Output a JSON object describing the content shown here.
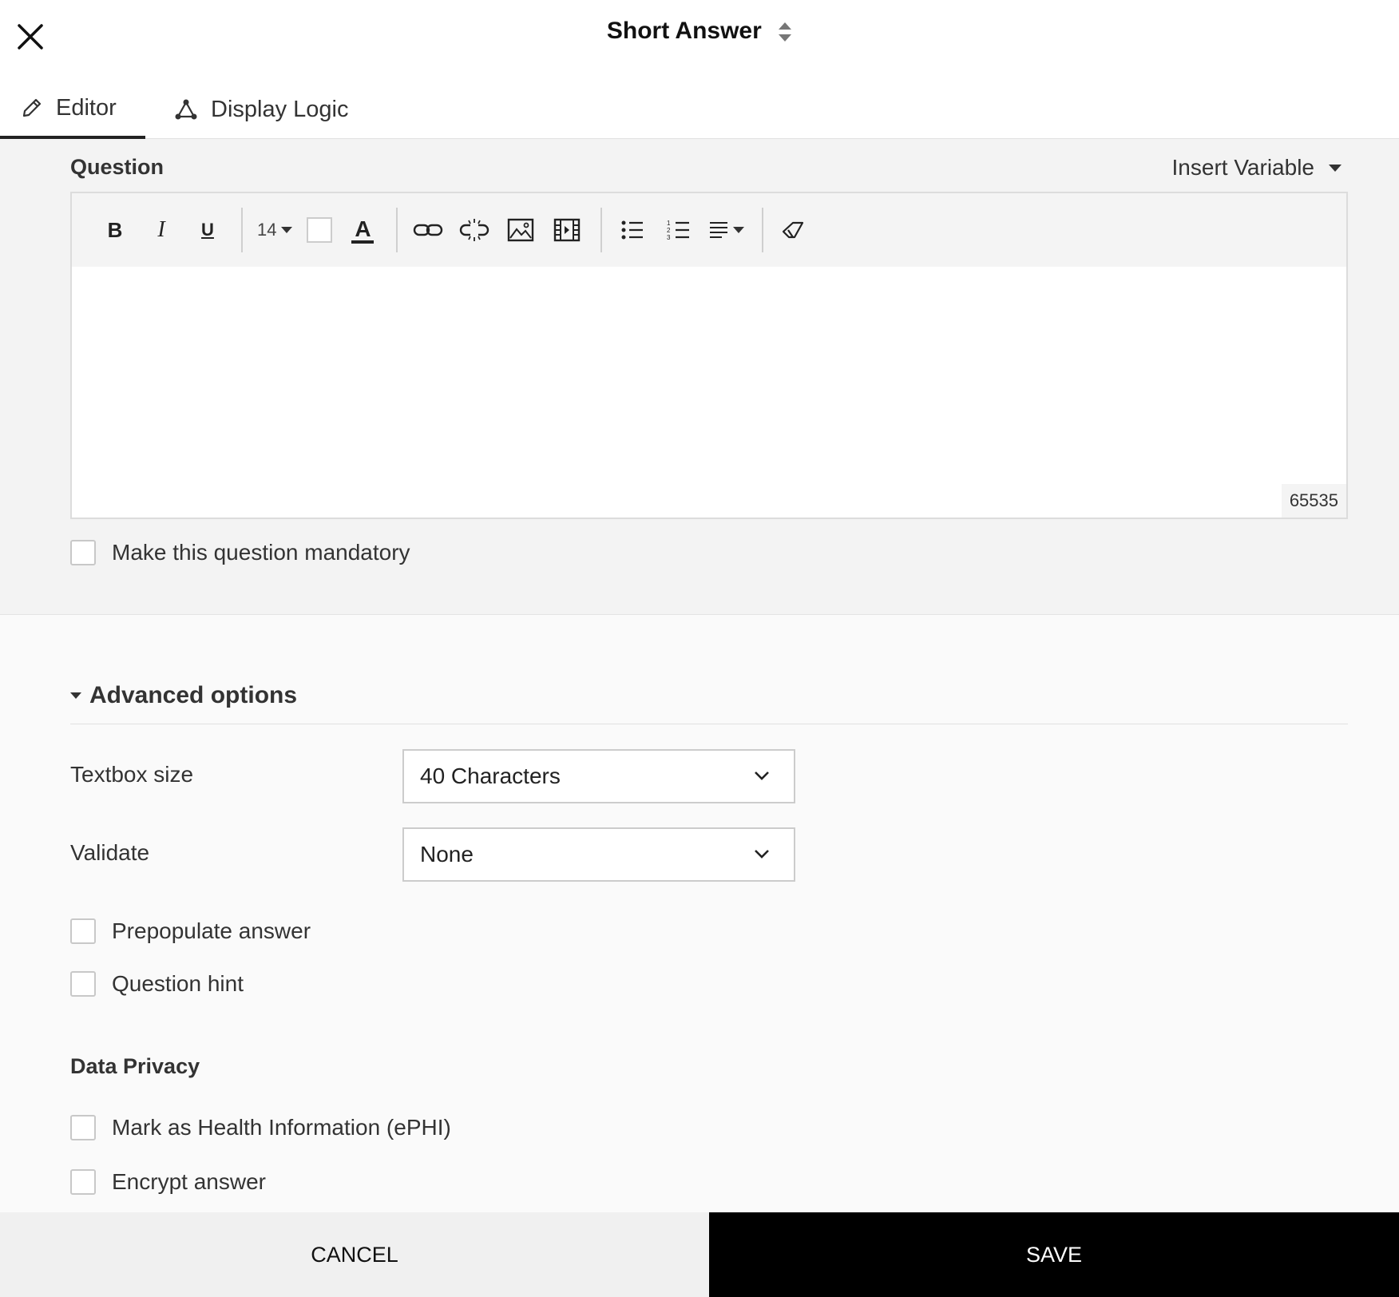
{
  "header": {
    "title": "Short Answer",
    "tabs": [
      {
        "label": "Editor",
        "active": true,
        "icon": "pencil-icon"
      },
      {
        "label": "Display Logic",
        "active": false,
        "icon": "logic-nodes-icon"
      }
    ]
  },
  "question": {
    "label": "Question",
    "insert_variable": "Insert Variable",
    "font_size": "14",
    "char_count": "65535",
    "mandatory_label": "Make this question mandatory"
  },
  "advanced": {
    "title": "Advanced options",
    "textbox_size_label": "Textbox size",
    "textbox_size_value": "40 Characters",
    "validate_label": "Validate",
    "validate_value": "None",
    "prepopulate_label": "Prepopulate answer",
    "hint_label": "Question hint"
  },
  "privacy": {
    "title": "Data Privacy",
    "ephi_label": "Mark as Health Information (ePHI)",
    "encrypt_label": "Encrypt answer"
  },
  "footer": {
    "cancel": "CANCEL",
    "save": "SAVE"
  },
  "colors": {
    "save_bg": "#000000",
    "cancel_bg": "#f0f0f0",
    "panel_bg": "#f3f3f3"
  }
}
